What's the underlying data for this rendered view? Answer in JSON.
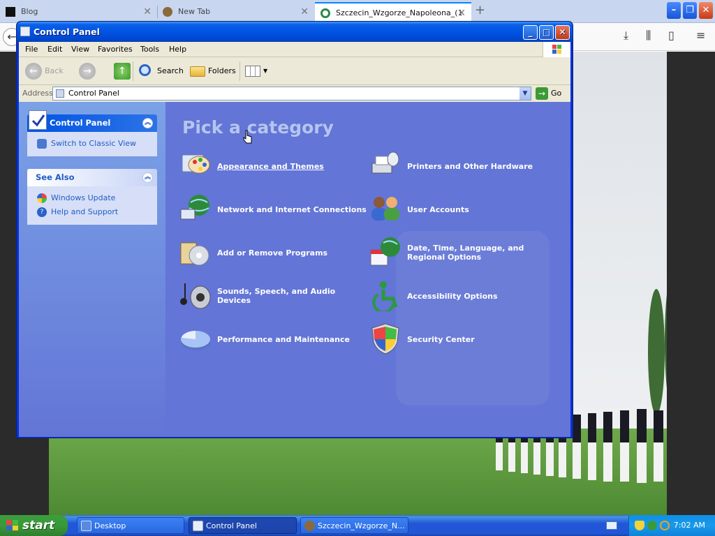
{
  "browser": {
    "tabs": [
      {
        "label": "Blog",
        "active": false
      },
      {
        "label": "New Tab",
        "active": false
      },
      {
        "label": "Szczecin_Wzgorze_Napoleona_(1",
        "active": true
      }
    ],
    "new_tab_label": "+",
    "close_tab_glyph": "✕"
  },
  "window": {
    "title": "Control Panel",
    "menu": [
      "File",
      "Edit",
      "View",
      "Favorites",
      "Tools",
      "Help"
    ],
    "toolbar": {
      "back_label": "Back",
      "search_label": "Search",
      "folders_label": "Folders"
    },
    "address": {
      "label": "Address",
      "value": "Control Panel",
      "go_label": "Go"
    }
  },
  "sidebar": {
    "control_panel": {
      "title": "Control Panel",
      "links": [
        "Switch to Classic View"
      ]
    },
    "see_also": {
      "title": "See Also",
      "links": [
        "Windows Update",
        "Help and Support"
      ]
    }
  },
  "main": {
    "heading": "Pick a category",
    "categories": [
      {
        "label": "Appearance and Themes",
        "icon": "appearance-icon"
      },
      {
        "label": "Printers and Other Hardware",
        "icon": "printer-icon"
      },
      {
        "label": "Network and Internet Connections",
        "icon": "network-icon"
      },
      {
        "label": "User Accounts",
        "icon": "users-icon"
      },
      {
        "label": "Add or Remove Programs",
        "icon": "programs-icon"
      },
      {
        "label": "Date, Time, Language, and Regional Options",
        "icon": "datetime-icon"
      },
      {
        "label": "Sounds, Speech, and Audio Devices",
        "icon": "sound-icon"
      },
      {
        "label": "Accessibility Options",
        "icon": "accessibility-icon"
      },
      {
        "label": "Performance and Maintenance",
        "icon": "performance-icon"
      },
      {
        "label": "Security Center",
        "icon": "security-shield-icon"
      }
    ]
  },
  "taskbar": {
    "start_label": "start",
    "tasks": [
      {
        "label": "Desktop",
        "active": false
      },
      {
        "label": "Control Panel",
        "active": true
      },
      {
        "label": "Szczecin_Wzgorze_N...",
        "active": false
      }
    ],
    "clock": "7:02 AM"
  },
  "colors": {
    "xp_blue": "#0054e3",
    "category_bg": "#6375d6",
    "taskbar": "#2157d7",
    "start_green": "#3c9c3c"
  }
}
